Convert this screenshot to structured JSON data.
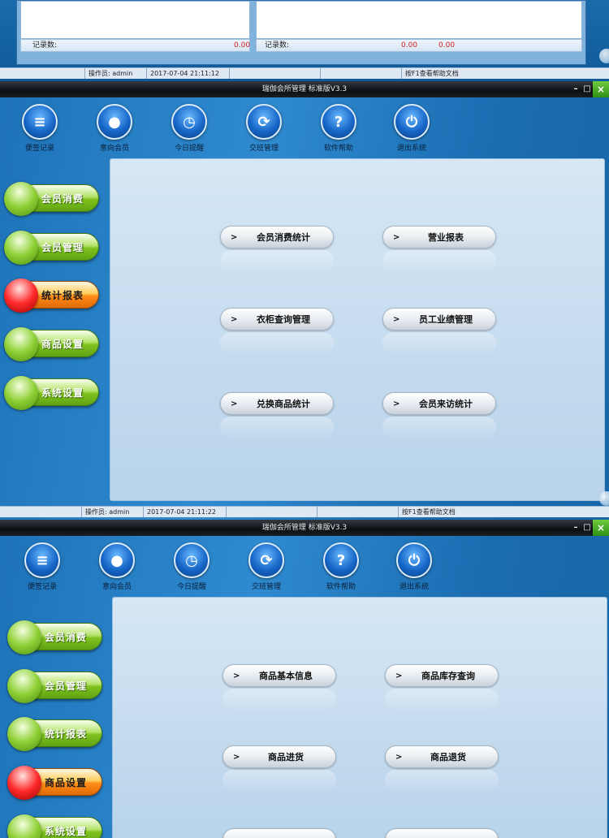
{
  "top": {
    "count_label": "记录数:",
    "left_amount": "0.00",
    "right_amount1": "0.00",
    "right_amount2": "0.00",
    "status": {
      "operator": "操作员: admin",
      "datetime": "2017-07-04 21:11:12",
      "help": "按F1查看帮助文档"
    }
  },
  "window1": {
    "title": "瑞伽会所管理 标准版V3.3",
    "toolbar": [
      {
        "label": "便签记录",
        "icon": "note-icon"
      },
      {
        "label": "意向会员",
        "icon": "member-icon"
      },
      {
        "label": "今日提醒",
        "icon": "clock-icon"
      },
      {
        "label": "交班管理",
        "icon": "refresh-icon"
      },
      {
        "label": "软件帮助",
        "icon": "help-icon"
      },
      {
        "label": "退出系统",
        "icon": "power-icon"
      }
    ],
    "sidebar": [
      "会员消费",
      "会员管理",
      "统计报表",
      "商品设置",
      "系统设置"
    ],
    "active_sidebar": "统计报表",
    "menu": [
      "会员消费统计",
      "营业报表",
      "衣柜查询管理",
      "员工业绩管理",
      "兑换商品统计",
      "会员来访统计"
    ],
    "status": {
      "operator": "操作员: admin",
      "datetime": "2017-07-04 21:11:22",
      "help": "按F1查看帮助文档"
    }
  },
  "window2": {
    "title": "瑞伽会所管理 标准版V3.3",
    "toolbar": [
      {
        "label": "便签记录",
        "icon": "note-icon"
      },
      {
        "label": "意向会员",
        "icon": "member-icon"
      },
      {
        "label": "今日提醒",
        "icon": "clock-icon"
      },
      {
        "label": "交班管理",
        "icon": "refresh-icon"
      },
      {
        "label": "软件帮助",
        "icon": "help-icon"
      },
      {
        "label": "退出系统",
        "icon": "power-icon"
      }
    ],
    "sidebar": [
      "会员消费",
      "会员管理",
      "统计报表",
      "商品设置",
      "系统设置"
    ],
    "active_sidebar": "商品设置",
    "menu": [
      "商品基本信息",
      "商品库存查询",
      "商品进货",
      "商品退货"
    ]
  },
  "colors": {
    "window_blue": "#1e73b8",
    "active_red": "#ff2a2a",
    "inactive_green": "#8fd036",
    "amount_red": "#d02020"
  }
}
